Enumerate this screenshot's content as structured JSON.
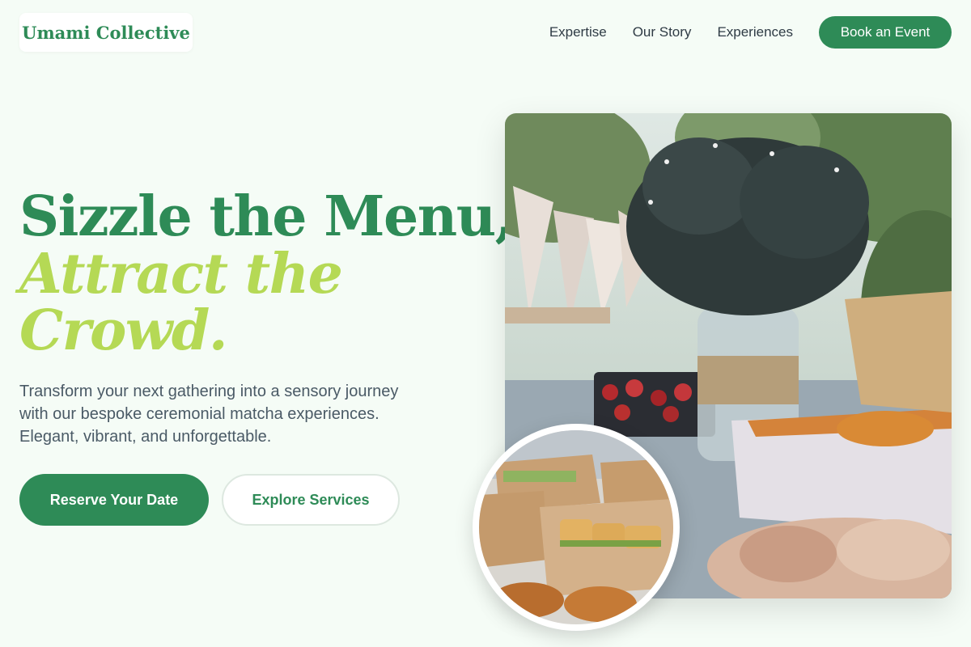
{
  "header": {
    "logo_text": "Umami Collective",
    "nav": [
      "Expertise",
      "Our Story",
      "Experiences"
    ],
    "book_button": "Book an Event"
  },
  "hero": {
    "headline_line1": "Sizzle the Menu,",
    "headline_line2": "Attract the Crowd.",
    "description": "Transform your next gathering into a sensory journey with our bespoke ceremonial matcha experiences. Elegant, vibrant, and unforgettable.",
    "primary_cta": "Reserve Your Date",
    "secondary_cta": "Explore Services"
  },
  "colors": {
    "brand_green": "#2e8b57",
    "accent_lime": "#b5d955",
    "background": "#f5fcf6",
    "body_text": "#4a5a66"
  },
  "images": {
    "main_photo": "outdoor-catering-table-photo",
    "inset_photo": "boxed-sandwiches-photo"
  }
}
